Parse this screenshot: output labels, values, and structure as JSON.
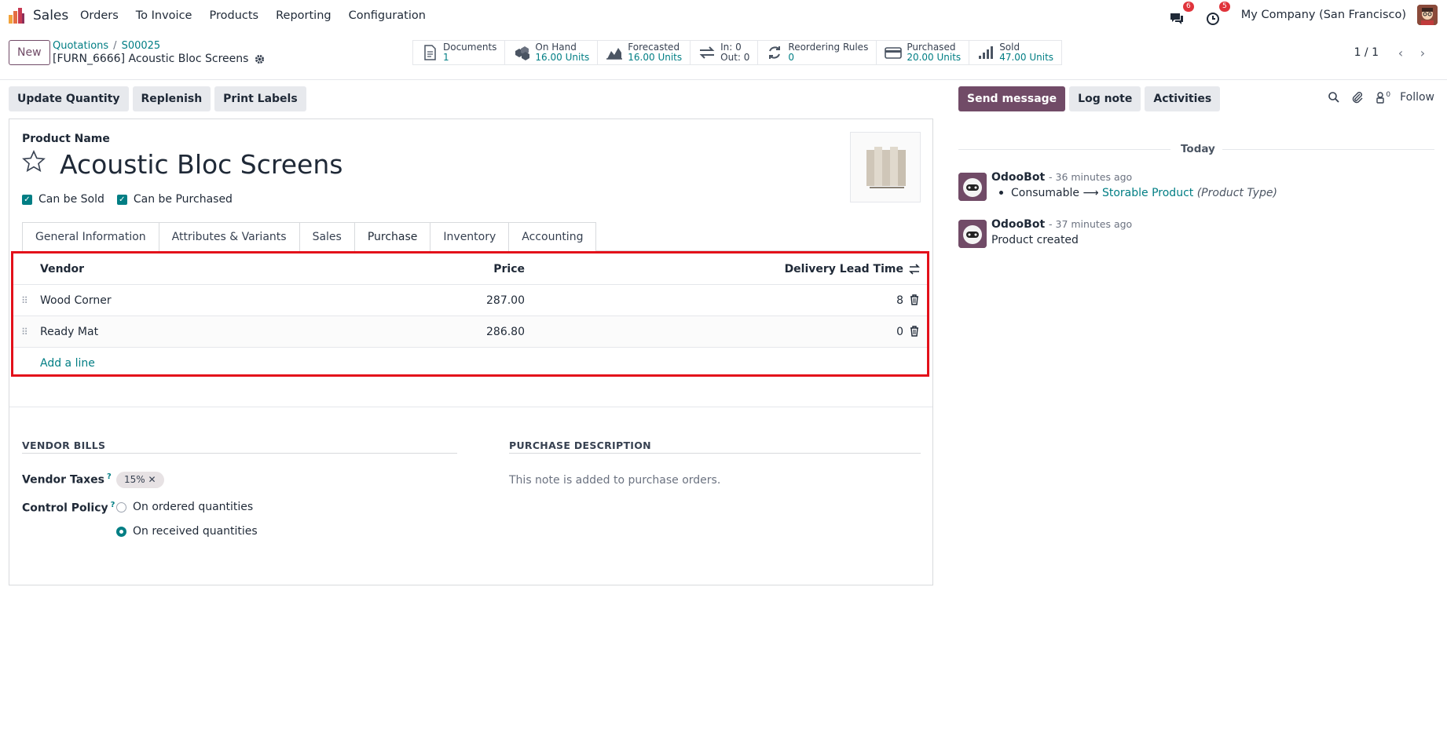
{
  "navbar": {
    "app_name": "Sales",
    "menu": [
      "Orders",
      "To Invoice",
      "Products",
      "Reporting",
      "Configuration"
    ],
    "messages_badge": "6",
    "activities_badge": "5",
    "company": "My Company (San Francisco)"
  },
  "control_panel": {
    "new_label": "New",
    "breadcrumb": [
      "Quotations",
      "S00025"
    ],
    "record_title": "[FURN_6666] Acoustic Bloc Screens",
    "smart_buttons": [
      {
        "label": "Documents",
        "value": "1"
      },
      {
        "label": "On Hand",
        "value": "16.00 Units"
      },
      {
        "label": "Forecasted",
        "value": "16.00 Units"
      },
      {
        "label": "In: 0",
        "value": "Out: 0"
      },
      {
        "label": "Reordering Rules",
        "value": "0"
      },
      {
        "label": "Purchased",
        "value": "20.00 Units"
      },
      {
        "label": "Sold",
        "value": "47.00 Units"
      }
    ],
    "pager": "1 / 1"
  },
  "action_bar": {
    "update_quantity": "Update Quantity",
    "replenish": "Replenish",
    "print_labels": "Print Labels"
  },
  "form": {
    "product_name_label": "Product Name",
    "product_name": "Acoustic Bloc Screens",
    "can_be_sold": "Can be Sold",
    "can_be_purchased": "Can be Purchased",
    "tabs": [
      "General Information",
      "Attributes & Variants",
      "Sales",
      "Purchase",
      "Inventory",
      "Accounting"
    ],
    "active_tab": "Purchase",
    "vendor_table": {
      "columns": [
        "Vendor",
        "Price",
        "Delivery Lead Time"
      ],
      "rows": [
        {
          "vendor": "Wood Corner",
          "price": "287.00",
          "lead_time": "8"
        },
        {
          "vendor": "Ready Mat",
          "price": "286.80",
          "lead_time": "0"
        }
      ],
      "add_line": "Add a line"
    },
    "vendor_bills_title": "VENDOR BILLS",
    "purchase_description_title": "PURCHASE DESCRIPTION",
    "vendor_taxes_label": "Vendor Taxes",
    "vendor_taxes_tag": "15%",
    "control_policy_label": "Control Policy",
    "control_policy_options": [
      "On ordered quantities",
      "On received quantities"
    ],
    "control_policy_selected": "On received quantities",
    "purchase_description_placeholder": "This note is added to purchase orders.",
    "help_mark": "?"
  },
  "chatter": {
    "send_message": "Send message",
    "log_note": "Log note",
    "activities": "Activities",
    "followers_count": "0",
    "follow": "Follow",
    "today": "Today",
    "messages": [
      {
        "author": "OdooBot",
        "time": "- 36 minutes ago",
        "old_value": "Consumable",
        "arrow": "⟶",
        "new_value": "Storable Product",
        "field": "(Product Type)"
      },
      {
        "author": "OdooBot",
        "time": "- 37 minutes ago",
        "body": "Product created"
      }
    ]
  },
  "colors": {
    "brand": "#714B67",
    "link": "#017e84",
    "highlight": "#e3101a"
  }
}
